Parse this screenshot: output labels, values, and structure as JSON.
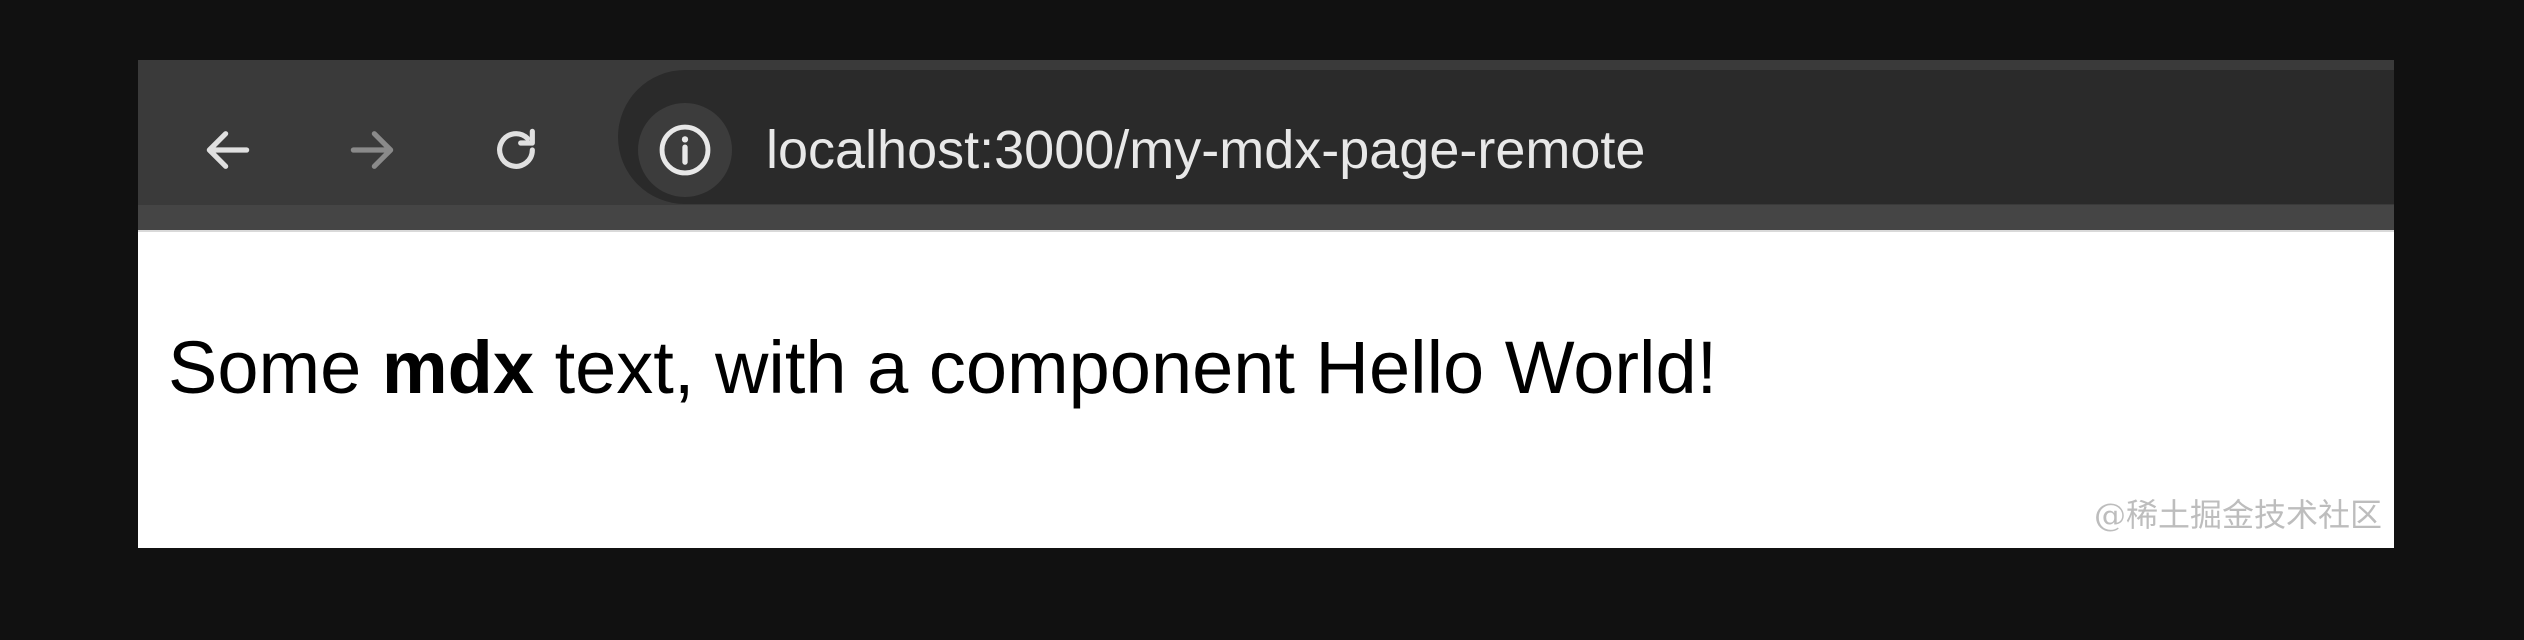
{
  "browser": {
    "url": "localhost:3000/my-mdx-page-remote",
    "nav": {
      "back_icon": "arrow-left-icon",
      "forward_icon": "arrow-right-icon",
      "reload_icon": "reload-icon",
      "site_info_icon": "info-circle-icon"
    }
  },
  "page": {
    "text_before": "Some ",
    "text_bold": "mdx",
    "text_after": " text, with a component Hello World!"
  },
  "watermark": {
    "text": "@稀土掘金技术社区"
  },
  "colors": {
    "background": "#111111",
    "toolbar": "#3a3a3a",
    "address_bar": "#2a2a2a",
    "url_text": "#e8e8e8",
    "icon_active": "#e0e0e0",
    "icon_disabled": "#8a8a8a"
  }
}
